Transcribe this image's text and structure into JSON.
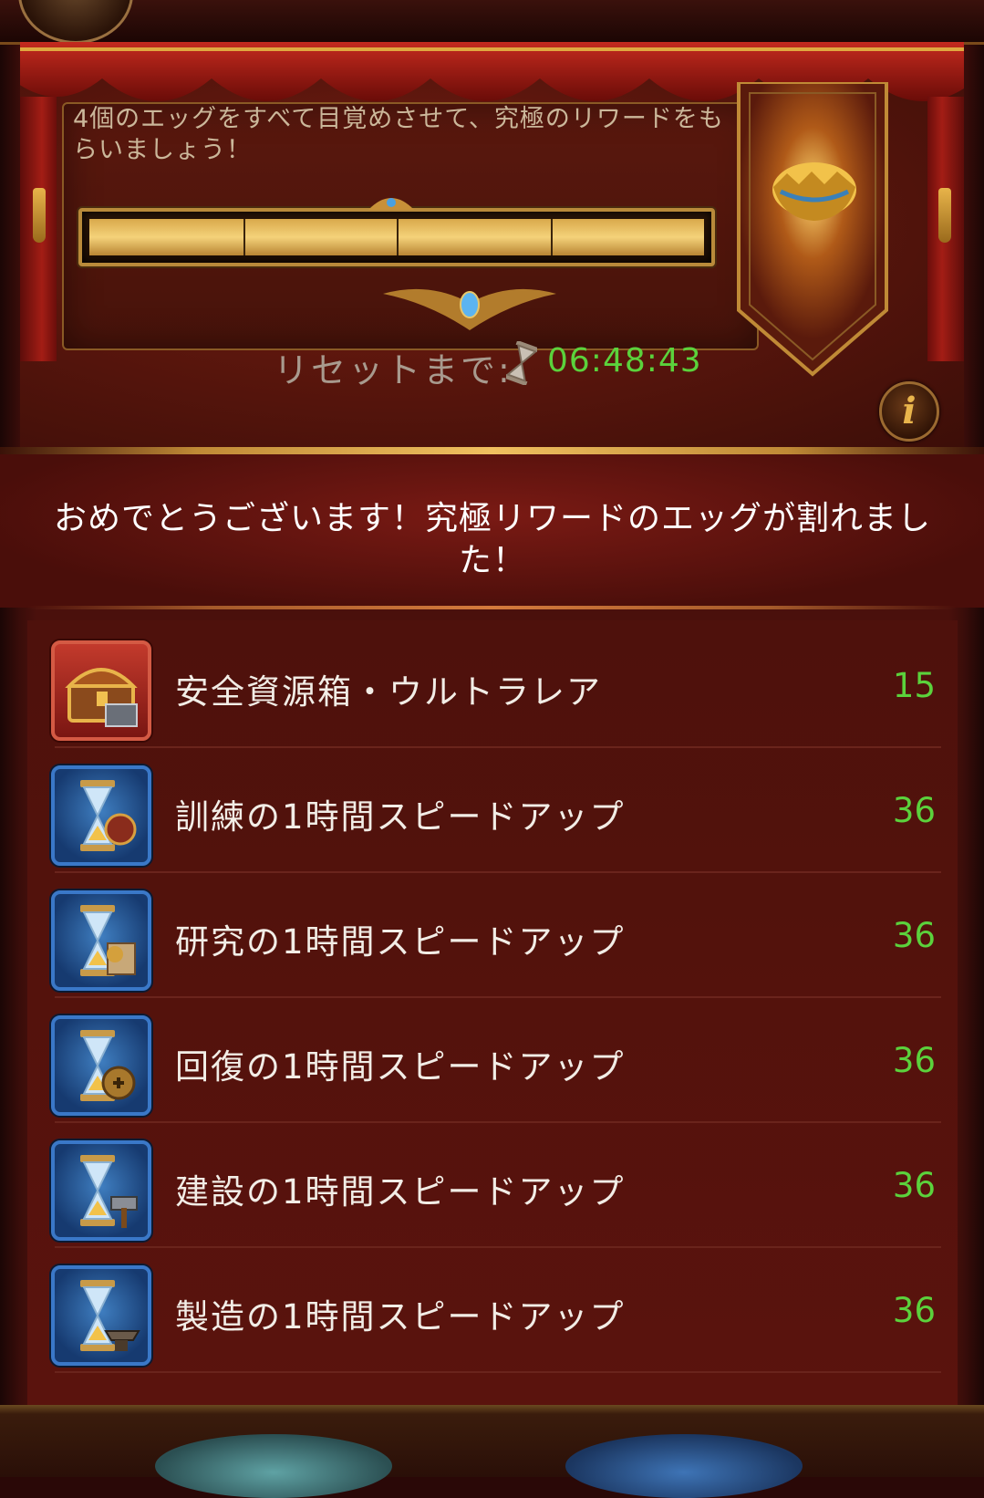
{
  "event": {
    "goal_text": "4個のエッグをすべて目覚めさせて、究極のリワードをもらいましょう！",
    "progress": {
      "segments": 4,
      "filled": 4
    },
    "reset_label": "リセットまで:",
    "reset_timer": "06:48:43",
    "info_icon": "i"
  },
  "message": "おめでとうございます！究極リワードのエッグが割れました！",
  "rewards": [
    {
      "label": "安全資源箱・ウルトラレア",
      "quantity": "15",
      "icon": "resource-chest-icon",
      "frame": "red"
    },
    {
      "label": "訓練の1時間スピードアップ",
      "quantity": "36",
      "icon": "training-speedup-icon",
      "frame": "blue"
    },
    {
      "label": "研究の1時間スピードアップ",
      "quantity": "36",
      "icon": "research-speedup-icon",
      "frame": "blue"
    },
    {
      "label": "回復の1時間スピードアップ",
      "quantity": "36",
      "icon": "healing-speedup-icon",
      "frame": "blue"
    },
    {
      "label": "建設の1時間スピードアップ",
      "quantity": "36",
      "icon": "construction-speedup-icon",
      "frame": "blue"
    },
    {
      "label": "製造の1時間スピードアップ",
      "quantity": "36",
      "icon": "manufacturing-speedup-icon",
      "frame": "blue"
    }
  ],
  "colors": {
    "quantity_green": "#5bd23c",
    "timer_green": "#5bd23c",
    "gold": "#e0a840"
  }
}
